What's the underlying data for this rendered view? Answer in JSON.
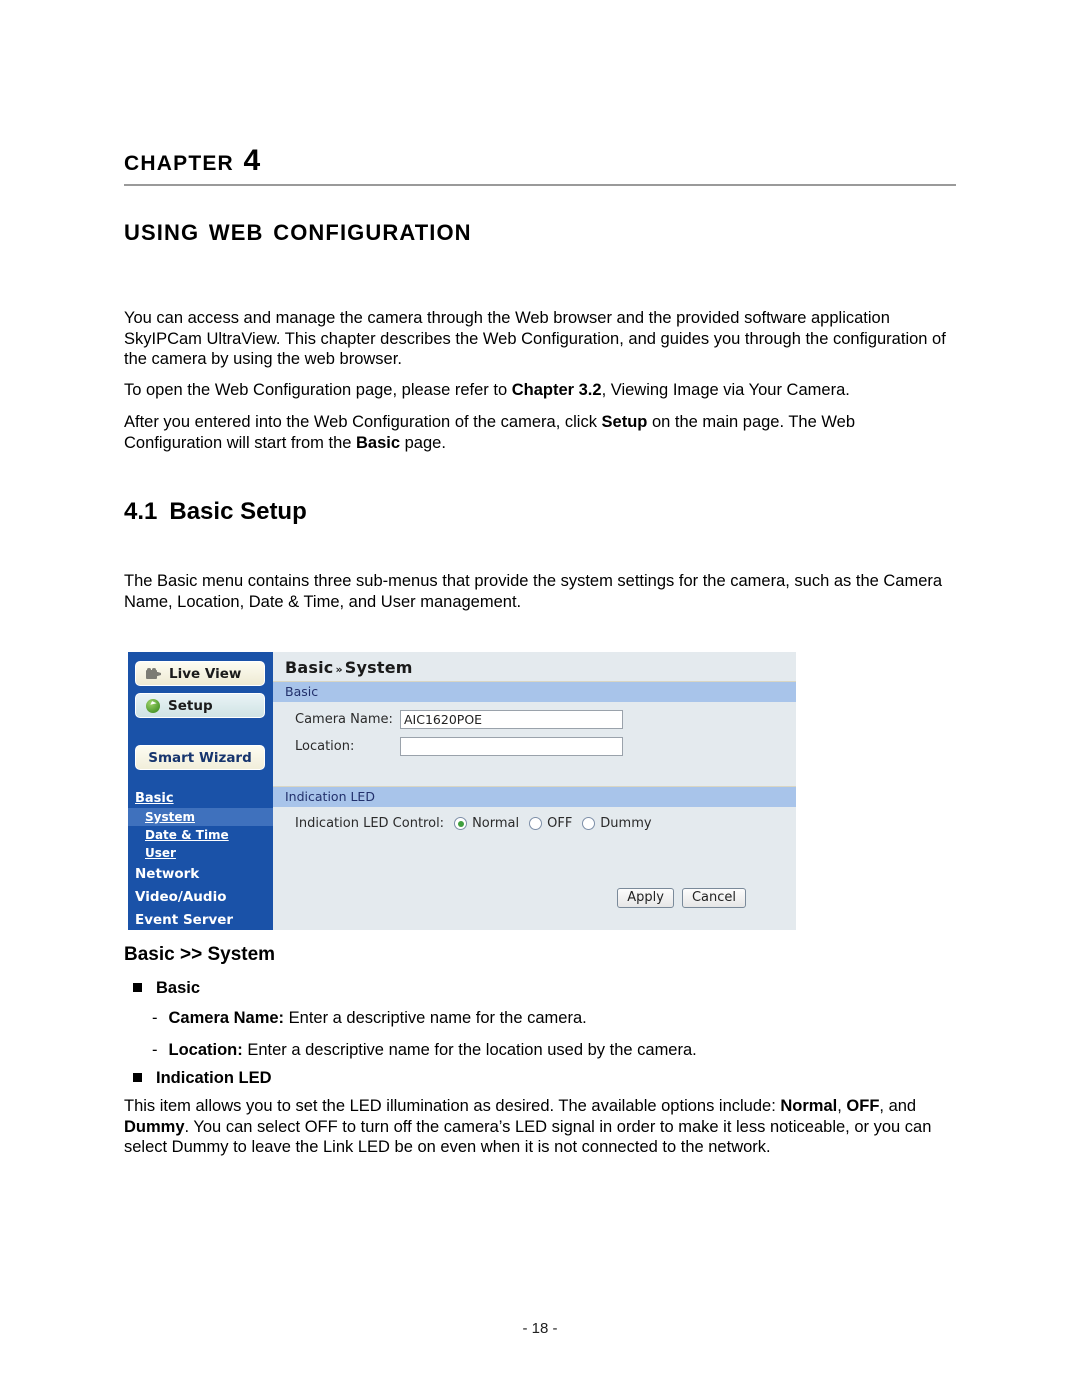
{
  "chapter": {
    "label": "Chapter 4",
    "title": "Using Web Configuration"
  },
  "paragraphs": {
    "intro_1_a": "You can access and manage the camera through the Web browser and the provided software application SkyIPCam UltraView. This chapter describes the Web Configuration, and guides you through the configuration of the camera by using the web browser.",
    "intro_2_a": "To open the Web Configuration page, please refer to ",
    "intro_2_b": "Chapter 3.2",
    "intro_2_c": ", Viewing Image via Your Camera.",
    "intro_3_a": "After you entered into the Web Configuration of the camera, click ",
    "intro_3_b": "Setup",
    "intro_3_c": " on the main page. The Web Configuration will start from the ",
    "intro_3_d": "Basic",
    "intro_3_e": " page.",
    "basic_menu": "The Basic menu contains three sub-menus that provide the system settings for the camera, such as the Camera Name, Location, Date & Time, and User management.",
    "led_desc_a": "This item allows you to set the LED illumination as desired. The available options include: ",
    "led_desc_b": "Normal",
    "led_desc_c": ", ",
    "led_desc_d": "OFF",
    "led_desc_e": ", and ",
    "led_desc_f": "Dummy",
    "led_desc_g": ". You can select OFF to turn off the camera’s LED signal in order to make it less noticeable, or you can select Dummy to leave the Link LED be on even when it is not connected to the network."
  },
  "section": {
    "number": "4.1",
    "title": "Basic Setup"
  },
  "screenshot": {
    "sidebar": {
      "live_view": "Live View",
      "setup": "Setup",
      "smart_wizard": "Smart Wizard",
      "nav": {
        "basic": "Basic",
        "system": "System",
        "date_time": "Date & Time",
        "user": "User",
        "network": "Network",
        "video_audio": "Video/Audio",
        "event_server": "Event Server"
      }
    },
    "main": {
      "breadcrumb_root": "Basic",
      "breadcrumb_sep": "»",
      "breadcrumb_leaf": "System",
      "section_basic": "Basic",
      "camera_name_label": "Camera Name:",
      "camera_name_value": "AIC1620POE",
      "location_label": "Location:",
      "location_value": "",
      "section_led": "Indication LED",
      "led_control_label": "Indication LED Control:",
      "led_options": [
        "Normal",
        "OFF",
        "Dummy"
      ],
      "led_selected": "Normal",
      "apply": "Apply",
      "cancel": "Cancel"
    },
    "colors": {
      "sidebar_blue": "#1a52a8",
      "active_nav_blue": "#3f71bd",
      "section_bar_blue": "#a8c4ea",
      "content_bg": "#e4eaee",
      "radio_green": "#3f9f3f"
    }
  },
  "details": {
    "heading": "Basic >> System",
    "bullet_basic": "Basic",
    "bullet_led": "Indication LED",
    "dash_mark": "-",
    "camera_name_term": "Camera Name:",
    "camera_name_def": " Enter a descriptive name for the camera.",
    "location_term": "Location:",
    "location_def": " Enter a descriptive name for the location used by the camera."
  },
  "footer": {
    "page": "- 18 -"
  }
}
